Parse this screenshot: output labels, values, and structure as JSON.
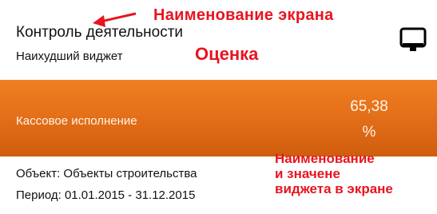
{
  "header": {
    "title": "Контроль деятельности",
    "worst_widget_label": "Наихудший виджет"
  },
  "widget": {
    "name": "Кассовое исполнение",
    "value": "65,38",
    "unit": "%",
    "tile_color": "#e5701a"
  },
  "details": {
    "object": "Объект: Объекты строительства",
    "period": "Период: 01.01.2015 - 31.12.2015"
  },
  "annotations": {
    "screen_name": "Наименование экрана",
    "rating": "Оценка",
    "widget_line1": "Наименование",
    "widget_line2": "и значене",
    "widget_line3": "виджета в экране",
    "color": "#e8141f"
  },
  "icons": {
    "display_mode": "monitor-icon",
    "pointer": "arrow-icon"
  }
}
